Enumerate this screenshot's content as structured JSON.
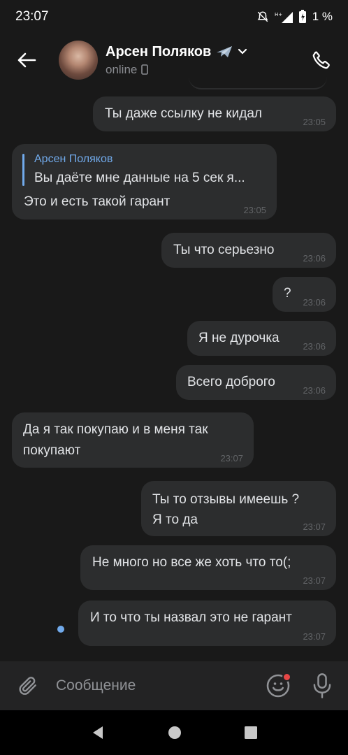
{
  "status_bar": {
    "time": "23:07",
    "battery_text": "1 %"
  },
  "header": {
    "contact_name": "Арсен Поляков",
    "contact_status": "online"
  },
  "messages": [
    {
      "direction": "out",
      "text": "Ты даже ссылку не кидал",
      "time": "23:05"
    },
    {
      "direction": "in",
      "reply_author": "Арсен Поляков",
      "reply_text": "Вы даёте мне данные на 5 сек я...",
      "text": "Это и есть такой гарант",
      "time": "23:05"
    },
    {
      "direction": "out",
      "text": "Ты что серьезно",
      "time": "23:06"
    },
    {
      "direction": "out",
      "text": "?",
      "time": "23:06"
    },
    {
      "direction": "out",
      "text": "Я не дурочка",
      "time": "23:06"
    },
    {
      "direction": "out",
      "text": "Всего доброго",
      "time": "23:06"
    },
    {
      "direction": "in",
      "text_line1": "Да я так покупаю и в меня так",
      "text_line2": "покупают",
      "time": "23:07"
    },
    {
      "direction": "out",
      "text_line1": "Ты то отзывы имеешь ?",
      "text_line2": "Я то да",
      "time": "23:07"
    },
    {
      "direction": "out",
      "text": "Не много но все же хоть что то(;",
      "time": "23:07"
    },
    {
      "direction": "out",
      "text": "И то что ты назвал это не гарант",
      "time": "23:07",
      "unread": true
    }
  ],
  "composer": {
    "placeholder": "Сообщение"
  },
  "colors": {
    "background": "#191919",
    "bubble": "#2c2d2e",
    "accent": "#71aaeb",
    "badge": "#e64646"
  },
  "icons": [
    "back-arrow-icon",
    "airplane-icon",
    "chevron-down-icon",
    "phone-icon",
    "mobile-device-icon",
    "paperclip-icon",
    "emoji-icon",
    "microphone-icon",
    "nav-back-icon",
    "nav-home-icon",
    "nav-recents-icon"
  ]
}
